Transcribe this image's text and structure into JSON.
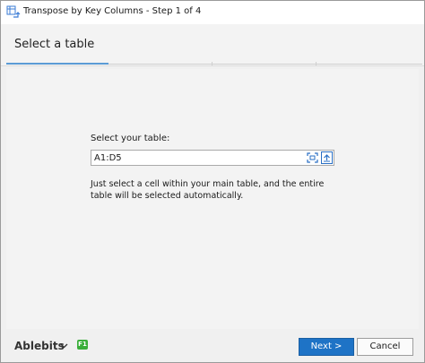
{
  "window": {
    "title": "Transpose by Key Columns - Step 1 of 4"
  },
  "step": {
    "title": "Select a table",
    "current": 1,
    "total": 4
  },
  "form": {
    "label": "Select your table:",
    "value": "A1:D5",
    "hint": "Just select a cell within your main table, and the entire table will be selected automatically."
  },
  "footer": {
    "brand": "Ablebits",
    "help_badge": "F1",
    "next_label": "Next >",
    "cancel_label": "Cancel"
  },
  "colors": {
    "accent": "#1e73c6",
    "progress": "#5b9bd5",
    "help_badge": "#3aae3a"
  }
}
